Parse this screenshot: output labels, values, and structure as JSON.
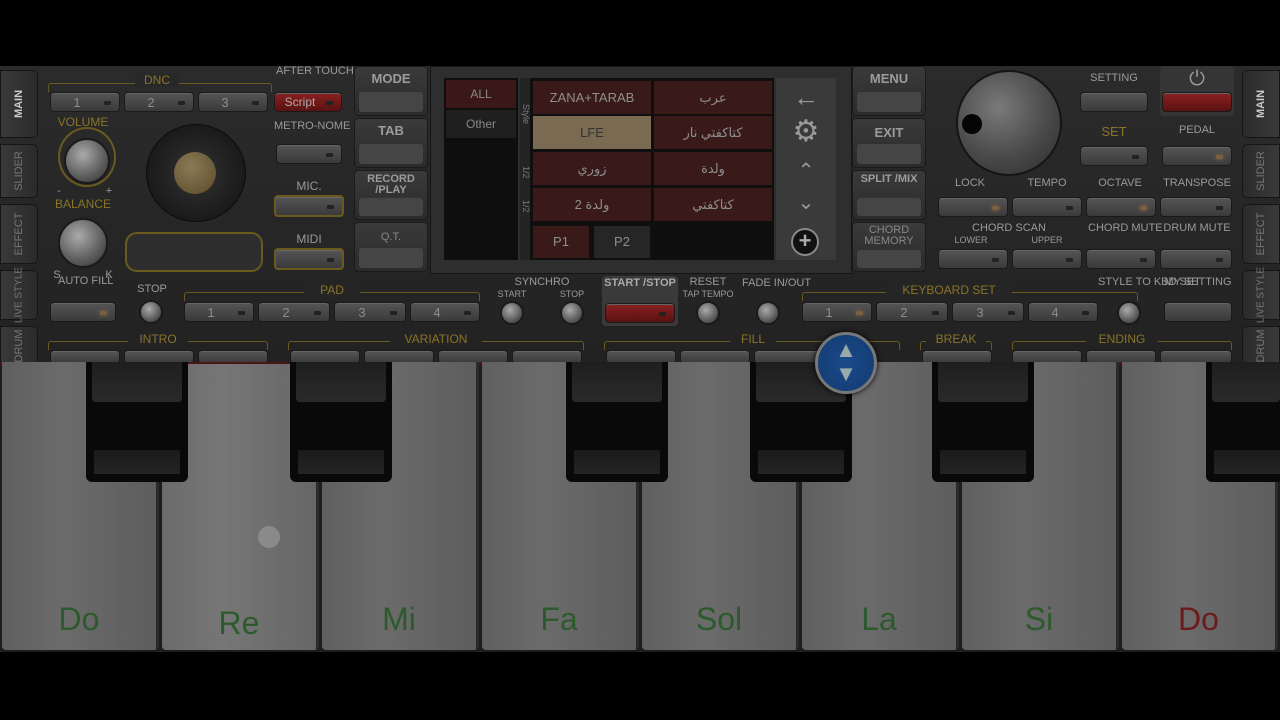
{
  "side_tabs_left": [
    "MAIN",
    "SLIDER",
    "EFFECT",
    "LIVE STYLE",
    "DRUM"
  ],
  "side_tabs_right": [
    "MAIN",
    "SLIDER",
    "EFFECT",
    "LIVE STYLE",
    "DRUM"
  ],
  "dnc": {
    "label": "DNC",
    "buttons": [
      "1",
      "2",
      "3"
    ],
    "script_label": "Script",
    "after_touch": "AFTER TOUCH"
  },
  "volume_label": "VOLUME",
  "balance_label": "BALANCE",
  "balance_left": "S",
  "balance_right": "K",
  "volume_min": "-",
  "volume_max": "+",
  "auto_fill": "AUTO FILL",
  "metronome": "METRO-NOME",
  "mic": "MIC.",
  "midi": "MIDI",
  "left_menu": {
    "mode": "MODE",
    "tab": "TAB",
    "record": "RECORD /PLAY",
    "qt": "Q.T."
  },
  "browser": {
    "categories": [
      "ALL",
      "Other"
    ],
    "side_label_style": "Style",
    "side_label_half1": "1/2",
    "side_label_half2": "1/2",
    "styles": [
      [
        "ZANA+TARAB",
        "عرب"
      ],
      [
        "LFE",
        "كتاكفتي نار"
      ],
      [
        "زوري",
        "ولدة"
      ],
      [
        "ولدة 2",
        "كتاكفتي"
      ]
    ],
    "selected": "LFE",
    "pages": [
      "P1",
      "P2"
    ]
  },
  "right_menu": {
    "menu": "MENU",
    "exit": "EXIT",
    "split": "SPLIT /MIX",
    "chord_memory": "CHORD MEMORY"
  },
  "right_panel": {
    "setting": "SETTING",
    "set": "SET",
    "pedal": "PEDAL",
    "lock": "LOCK",
    "tempo": "TEMPO",
    "octave": "OCTAVE",
    "transpose": "TRANSPOSE",
    "chord_scan": "CHORD SCAN",
    "lower": "LOWER",
    "upper": "UPPER",
    "chord_mute": "CHORD MUTE",
    "drum_mute": "DRUM MUTE"
  },
  "row_pad": {
    "stop": "STOP",
    "pad": "PAD",
    "pad_buttons": [
      "1",
      "2",
      "3",
      "4"
    ],
    "synchro": "SYNCHRO",
    "start": "START",
    "stop2": "STOP",
    "start_stop": "START /STOP",
    "reset": "RESET",
    "tap_tempo": "TAP TEMPO",
    "fade": "FADE IN/OUT",
    "keyboard_set": "KEYBOARD SET",
    "kb_buttons": [
      "1",
      "2",
      "3",
      "4"
    ],
    "style_to_kbd": "STYLE TO KBD SET",
    "my_setting": "MY SETTING"
  },
  "row_sections": {
    "intro": "INTRO",
    "variation": "VARIATION",
    "fill": "FILL",
    "break": "BREAK",
    "ending": "ENDING"
  },
  "keys": [
    {
      "note": "Do",
      "color": "#2c5a2c"
    },
    {
      "note": "Re",
      "color": "#2c5a2c"
    },
    {
      "note": "Mi",
      "color": "#2c5a2c"
    },
    {
      "note": "Fa",
      "color": "#2c5a2c"
    },
    {
      "note": "Sol",
      "color": "#2c5a2c"
    },
    {
      "note": "La",
      "color": "#2c5a2c"
    },
    {
      "note": "Si",
      "color": "#2c5a2c"
    },
    {
      "note": "Do",
      "color": "#6a1c1c"
    }
  ]
}
